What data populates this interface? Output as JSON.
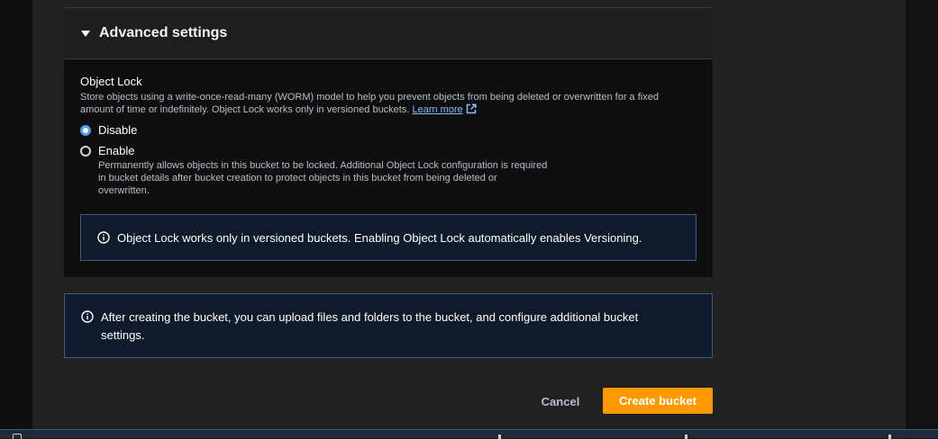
{
  "advanced_settings": {
    "title": "Advanced settings"
  },
  "object_lock": {
    "title": "Object Lock",
    "description": "Store objects using a write-once-read-many (WORM) model to help you prevent objects from being deleted or overwritten for a fixed amount of time or indefinitely. Object Lock works only in versioned buckets.",
    "learn_more": "Learn more",
    "options": [
      {
        "label": "Disable",
        "selected": true
      },
      {
        "label": "Enable",
        "selected": false,
        "description": "Permanently allows objects in this bucket to be locked. Additional Object Lock configuration is required in bucket details after bucket creation to protect objects in this bucket from being deleted or overwritten."
      }
    ],
    "info": "Object Lock works only in versioned buckets. Enabling Object Lock automatically enables Versioning."
  },
  "after_create_info": "After creating the bucket, you can upload files and folders to the bucket, and configure additional bucket settings.",
  "actions": {
    "cancel": "Cancel",
    "create": "Create bucket"
  },
  "colors": {
    "primary_button": "#ff9900",
    "link": "#89bdff",
    "info_border": "#3d5a80",
    "radio_selected": "#539fe5"
  },
  "icons": {
    "caret": "caret-down-icon",
    "info": "info-icon",
    "external": "external-link-icon"
  }
}
